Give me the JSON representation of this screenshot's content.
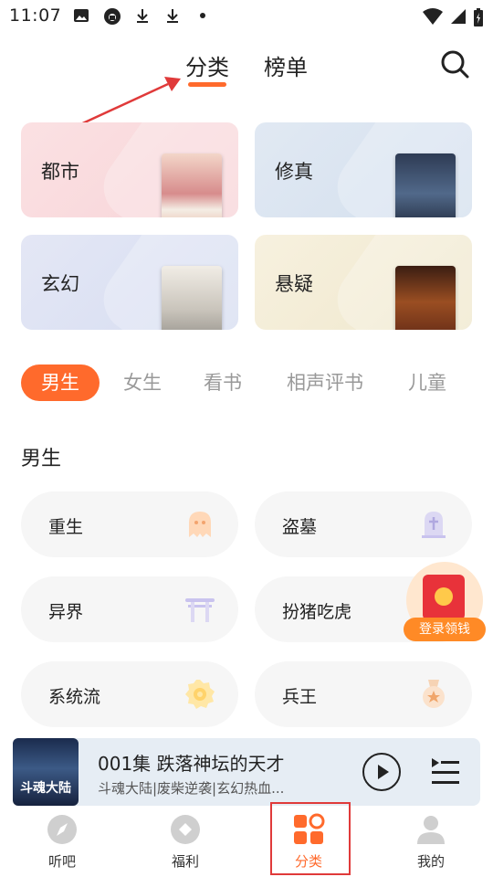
{
  "status_bar": {
    "time": "11:07"
  },
  "top_nav": {
    "tabs": [
      {
        "label": "分类",
        "active": true
      },
      {
        "label": "榜单",
        "active": false
      }
    ]
  },
  "genre_cards": [
    {
      "label": "都市"
    },
    {
      "label": "修真"
    },
    {
      "label": "玄幻"
    },
    {
      "label": "悬疑"
    }
  ],
  "categories": [
    {
      "label": "男生",
      "active": true
    },
    {
      "label": "女生",
      "active": false
    },
    {
      "label": "看书",
      "active": false
    },
    {
      "label": "相声评书",
      "active": false
    },
    {
      "label": "儿童",
      "active": false
    }
  ],
  "section": {
    "title": "男生"
  },
  "tags": [
    {
      "label": "重生",
      "icon": "ghost-icon"
    },
    {
      "label": "盗墓",
      "icon": "tombstone-icon"
    },
    {
      "label": "异界",
      "icon": "torii-gate-icon"
    },
    {
      "label": "扮猪吃虎",
      "icon": "pig-icon"
    },
    {
      "label": "系统流",
      "icon": "gear-badge-icon"
    },
    {
      "label": "兵王",
      "icon": "medal-icon"
    }
  ],
  "promo": {
    "label": "登录领钱"
  },
  "player": {
    "cover_text": "斗魂大陆",
    "title": "001集 跌落神坛的天才",
    "subtitle": "斗魂大陆|废柴逆袭|玄幻热血..."
  },
  "bottom_nav": [
    {
      "label": "听吧",
      "active": false
    },
    {
      "label": "福利",
      "active": false
    },
    {
      "label": "分类",
      "active": true
    },
    {
      "label": "我的",
      "active": false
    }
  ],
  "colors": {
    "accent": "#ff6a2c",
    "annotation": "#e03a3a"
  }
}
